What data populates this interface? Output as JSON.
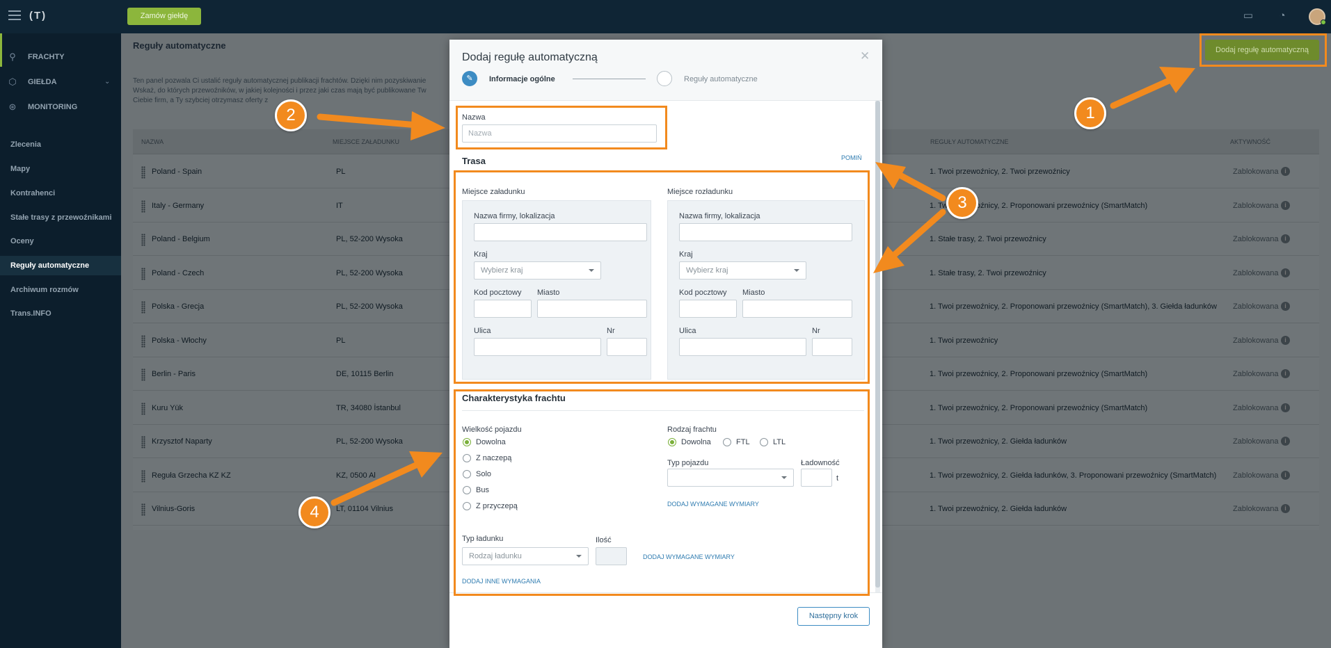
{
  "topbar": {
    "logo": "(T)",
    "order_button": "Zamów giełdę"
  },
  "sidebar": {
    "main_items": [
      {
        "label": "FRACHTY",
        "icon": "route-icon"
      },
      {
        "label": "GIEŁDA",
        "icon": "box-icon"
      },
      {
        "label": "MONITORING",
        "icon": "satellite-icon"
      }
    ],
    "sub_items": [
      {
        "label": "Zlecenia"
      },
      {
        "label": "Mapy"
      },
      {
        "label": "Kontrahenci"
      },
      {
        "label": "Stałe trasy z przewoźnikami"
      },
      {
        "label": "Oceny"
      },
      {
        "label": "Reguły automatyczne"
      },
      {
        "label": "Archiwum rozmów"
      },
      {
        "label": "Trans.INFO"
      }
    ]
  },
  "page": {
    "title": "Reguły automatyczne",
    "description_lines": [
      "Ten panel pozwala Ci ustalić reguły automatycznej publikacji frachtów. Dzięki nim pozyskiwanie",
      "Wskaż, do których przewoźników, w jakiej kolejności i przez jaki czas mają być publikowane Tw",
      "Ciebie firm, a Ty szybciej otrzymasz oferty z"
    ],
    "add_rule_button": "Dodaj regułę automatyczną"
  },
  "table": {
    "headers": [
      "NAZWA",
      "MIEJSCE ZAŁADUNKU",
      "REGUŁY AUTOMATYCZNE",
      "AKTYWNOŚĆ"
    ],
    "rows": [
      {
        "name": "Poland - Spain",
        "place": "PL",
        "rules": "1. Twoi przewoźnicy, 2. Twoi przewoźnicy",
        "status": "Zablokowana"
      },
      {
        "name": "Italy - Germany",
        "place": "IT",
        "rules": "1. Twoi przewoźnicy, 2. Proponowani przewoźnicy (SmartMatch)",
        "status": "Zablokowana"
      },
      {
        "name": "Poland - Belgium",
        "place": "PL, 52-200 Wysoka",
        "rules": "1. Stałe trasy, 2. Twoi przewoźnicy",
        "status": "Zablokowana"
      },
      {
        "name": "Poland - Czech",
        "place": "PL, 52-200 Wysoka",
        "rules": "1. Stałe trasy, 2. Twoi przewoźnicy",
        "status": "Zablokowana"
      },
      {
        "name": "Polska - Grecja",
        "place": "PL, 52-200 Wysoka",
        "rules": "1. Twoi przewoźnicy, 2. Proponowani przewoźnicy (SmartMatch), 3. Giełda ładunków",
        "status": "Zablokowana"
      },
      {
        "name": "Polska - Włochy",
        "place": "PL",
        "rules": "1. Twoi przewoźnicy",
        "status": "Zablokowana"
      },
      {
        "name": "Berlin - Paris",
        "place": "DE, 10115 Berlin",
        "rules": "1. Twoi przewoźnicy, 2. Proponowani przewoźnicy (SmartMatch)",
        "status": "Zablokowana"
      },
      {
        "name": "Kuru Yük",
        "place": "TR, 34080 İstanbul",
        "rules": "1. Twoi przewoźnicy, 2. Proponowani przewoźnicy (SmartMatch)",
        "status": "Zablokowana"
      },
      {
        "name": "Krzysztof Naparty",
        "place": "PL, 52-200 Wysoka",
        "rules": "1. Twoi przewoźnicy, 2. Giełda ładunków",
        "status": "Zablokowana"
      },
      {
        "name": "Reguła Grzecha KZ KZ",
        "place": "KZ, 0500 Al",
        "rules": "1. Twoi przewoźnicy, 2. Giełda ładunków, 3. Proponowani przewoźnicy (SmartMatch)",
        "status": "Zablokowana"
      },
      {
        "name": "Vilnius-Goris",
        "place": "LT, 01104 Vilnius",
        "rules": "1. Twoi przewoźnicy, 2. Giełda ładunków",
        "status": "Zablokowana"
      }
    ]
  },
  "modal": {
    "title": "Dodaj regułę automatyczną",
    "step1": "Informacje ogólne",
    "step2": "Reguły automatyczne",
    "name_label": "Nazwa",
    "name_placeholder": "Nazwa",
    "route_title": "Trasa",
    "skip_link": "POMIŃ",
    "loading": {
      "title": "Miejsce załadunku",
      "company_label": "Nazwa firmy, lokalizacja",
      "country_label": "Kraj",
      "country_placeholder": "Wybierz kraj",
      "postal_label": "Kod pocztowy",
      "city_label": "Miasto",
      "street_label": "Ulica",
      "nr_label": "Nr"
    },
    "unloading": {
      "title": "Miejsce rozładunku",
      "company_label": "Nazwa firmy, lokalizacja",
      "country_label": "Kraj",
      "country_placeholder": "Wybierz kraj",
      "postal_label": "Kod pocztowy",
      "city_label": "Miasto",
      "street_label": "Ulica",
      "nr_label": "Nr"
    },
    "freight": {
      "title": "Charakterystyka frachtu",
      "vehicle_size_label": "Wielkość pojazdu",
      "vehicle_sizes": [
        "Dowolna",
        "Z naczepą",
        "Solo",
        "Bus",
        "Z przyczepą"
      ],
      "vehicle_size_selected": "Dowolna",
      "freight_type_label": "Rodzaj frachtu",
      "freight_types": [
        "Dowolna",
        "FTL",
        "LTL"
      ],
      "freight_type_selected": "Dowolna",
      "vehicle_type_label": "Typ pojazdu",
      "capacity_label": "Ładowność",
      "capacity_unit": "t",
      "add_dims_1": "DODAJ WYMAGANE WYMIARY",
      "cargo_type_label": "Typ ładunku",
      "cargo_type_placeholder": "Rodzaj ładunku",
      "quantity_label": "Ilość",
      "add_dims_2": "DODAJ WYMAGANE WYMIARY",
      "add_other": "DODAJ INNE WYMAGANIA"
    },
    "next_button": "Następny krok"
  },
  "annotations": {
    "callouts": [
      "1",
      "2",
      "3",
      "4"
    ],
    "color": "#f28a1e"
  },
  "colors": {
    "topbar": "#0f2535",
    "sidebar": "#0c1e2c",
    "accent_green": "#8cb63c",
    "link_blue": "#2e7bb0",
    "annotation_orange": "#f28a1e"
  }
}
